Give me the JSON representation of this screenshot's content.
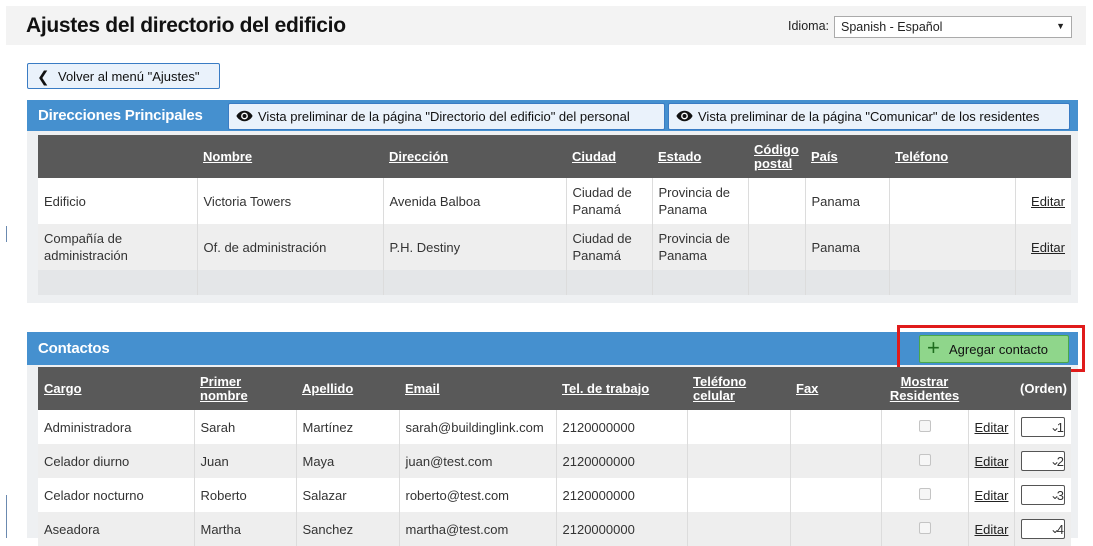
{
  "header": {
    "title": "Ajustes del directorio del edificio",
    "language_label": "Idioma:",
    "language_value": "Spanish - Español"
  },
  "back_button": {
    "label": "Volver al menú \"Ajustes\""
  },
  "principal": {
    "title": "Direcciones Principales",
    "preview_staff_label": "Vista preliminar de la página \"Directorio del edificio\" del personal",
    "preview_residents_label": "Vista preliminar de la página \"Comunicar\" de los residentes",
    "columns": [
      "",
      "Nombre",
      "Dirección",
      "Ciudad",
      "Estado",
      "Código postal",
      "País",
      "Teléfono",
      ""
    ],
    "rows": [
      {
        "type": "Edificio",
        "name": "Victoria Towers",
        "address": "Avenida Balboa",
        "city": "Ciudad de Panamá",
        "state": "Provincia de Panama",
        "zip": "",
        "country": "Panama",
        "phone": "",
        "action": "Editar"
      },
      {
        "type": "Compañía de administración",
        "name": "Of. de administración",
        "address": "P.H. Destiny",
        "city": "Ciudad de Panamá",
        "state": "Provincia de Panama",
        "zip": "",
        "country": "Panama",
        "phone": "",
        "action": "Editar"
      }
    ]
  },
  "contacts": {
    "title": "Contactos",
    "add_label": "Agregar contacto",
    "columns": [
      "Cargo",
      "Primer nombre",
      "Apellido",
      "Email",
      "Tel. de trabajo",
      "Teléfono celular",
      "Fax",
      "Mostrar Residentes",
      "",
      "(Orden)"
    ],
    "rows": [
      {
        "role": "Administradora",
        "first": "Sarah",
        "last": "Martínez",
        "email": "sarah@buildinglink.com",
        "work_phone": "2120000000",
        "mobile": "",
        "fax": "",
        "action": "Editar",
        "order": "1"
      },
      {
        "role": "Celador diurno",
        "first": "Juan",
        "last": "Maya",
        "email": "juan@test.com",
        "work_phone": "2120000000",
        "mobile": "",
        "fax": "",
        "action": "Editar",
        "order": "2"
      },
      {
        "role": "Celador nocturno",
        "first": "Roberto",
        "last": "Salazar",
        "email": "roberto@test.com",
        "work_phone": "2120000000",
        "mobile": "",
        "fax": "",
        "action": "Editar",
        "order": "3"
      },
      {
        "role": "Aseadora",
        "first": "Martha",
        "last": "Sanchez",
        "email": "martha@test.com",
        "work_phone": "2120000000",
        "mobile": "",
        "fax": "",
        "action": "Editar",
        "order": "4"
      }
    ]
  },
  "colors": {
    "panel_header": "#4590cf",
    "table_header": "#595959",
    "add_button": "#8fd68b",
    "highlight": "#e01b1b"
  },
  "icons": {
    "back": "chevron-left-icon",
    "preview": "eye-icon",
    "add": "plus-icon",
    "select": "chevron-down-icon"
  }
}
